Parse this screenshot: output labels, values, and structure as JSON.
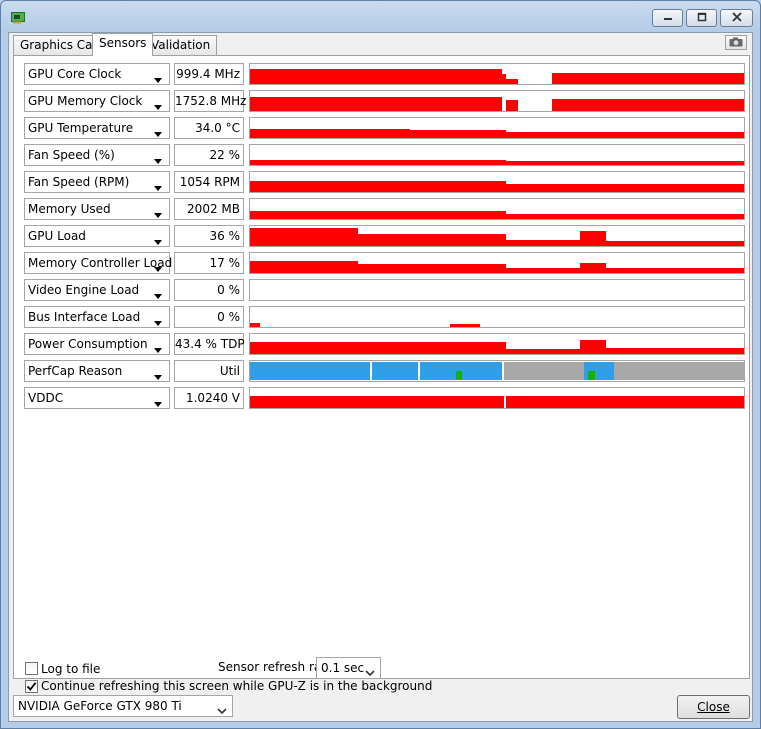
{
  "window": {
    "icon": "gpu-card-icon",
    "buttons": [
      "minimize-icon",
      "maximize-icon",
      "close-x-icon"
    ]
  },
  "tabs": [
    {
      "label": "Graphics Card",
      "active": false
    },
    {
      "label": "Sensors",
      "active": true
    },
    {
      "label": "Validation",
      "active": false
    }
  ],
  "screenshot_icon": "camera-icon",
  "colors": {
    "graph": "#ff0000",
    "perfcap_util": "#2e9fe8",
    "perfcap_idle": "#a8a8a8",
    "perfcap_vrel": "#12b012"
  },
  "sensors": [
    {
      "name": "GPU Core Clock",
      "value": "999.4 MHz"
    },
    {
      "name": "GPU Memory Clock",
      "value": "1752.8 MHz"
    },
    {
      "name": "GPU Temperature",
      "value": "34.0 °C"
    },
    {
      "name": "Fan Speed (%)",
      "value": "22 %"
    },
    {
      "name": "Fan Speed (RPM)",
      "value": "1054 RPM"
    },
    {
      "name": "Memory Used",
      "value": "2002 MB"
    },
    {
      "name": "GPU Load",
      "value": "36 %"
    },
    {
      "name": "Memory Controller Load",
      "value": "17 %"
    },
    {
      "name": "Video Engine Load",
      "value": "0 %"
    },
    {
      "name": "Bus Interface Load",
      "value": "0 %"
    },
    {
      "name": "Power Consumption",
      "value": "43.4 % TDP"
    },
    {
      "name": "PerfCap Reason",
      "value": "Util"
    },
    {
      "name": "VDDC",
      "value": "1.0240 V"
    }
  ],
  "footer": {
    "log_to_file": {
      "label": "Log to file",
      "checked": false
    },
    "refresh_label": "Sensor refresh rate:",
    "refresh_value": "0.1 sec",
    "continue_refresh": {
      "label": "Continue refreshing this screen while GPU-Z is in the background",
      "checked": true
    },
    "gpu_select": "NVIDIA GeForce GTX 980 Ti",
    "close_button": "Close"
  }
}
